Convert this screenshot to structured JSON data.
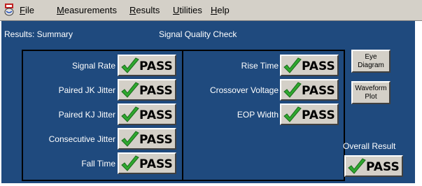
{
  "menu": {
    "file": "File",
    "measurements": "Measurements",
    "results": "Results",
    "utilities": "Utilities",
    "help": "Help"
  },
  "header": {
    "results_title": "Results: Summary",
    "check_title": "Signal Quality Check"
  },
  "left_results": [
    {
      "label": "Signal Rate",
      "status": "PASS"
    },
    {
      "label": "Paired JK Jitter",
      "status": "PASS"
    },
    {
      "label": "Paired KJ Jitter",
      "status": "PASS"
    },
    {
      "label": "Consecutive Jitter",
      "status": "PASS"
    },
    {
      "label": "Fall Time",
      "status": "PASS"
    }
  ],
  "right_results": [
    {
      "label": "Rise Time",
      "status": "PASS"
    },
    {
      "label": "Crossover Voltage",
      "status": "PASS"
    },
    {
      "label": "EOP Width",
      "status": "PASS"
    }
  ],
  "buttons": {
    "eye_line1": "Eye",
    "eye_line2": "Diagram",
    "waveform_line1": "Waveform",
    "waveform_line2": "Plot"
  },
  "overall": {
    "label": "Overall Result",
    "status": "PASS"
  },
  "colors": {
    "panel_bg": "#1f4a7e",
    "check_green": "#2fa82f"
  },
  "icons": {
    "pass": "checkmark-icon",
    "app": "app-icon"
  }
}
